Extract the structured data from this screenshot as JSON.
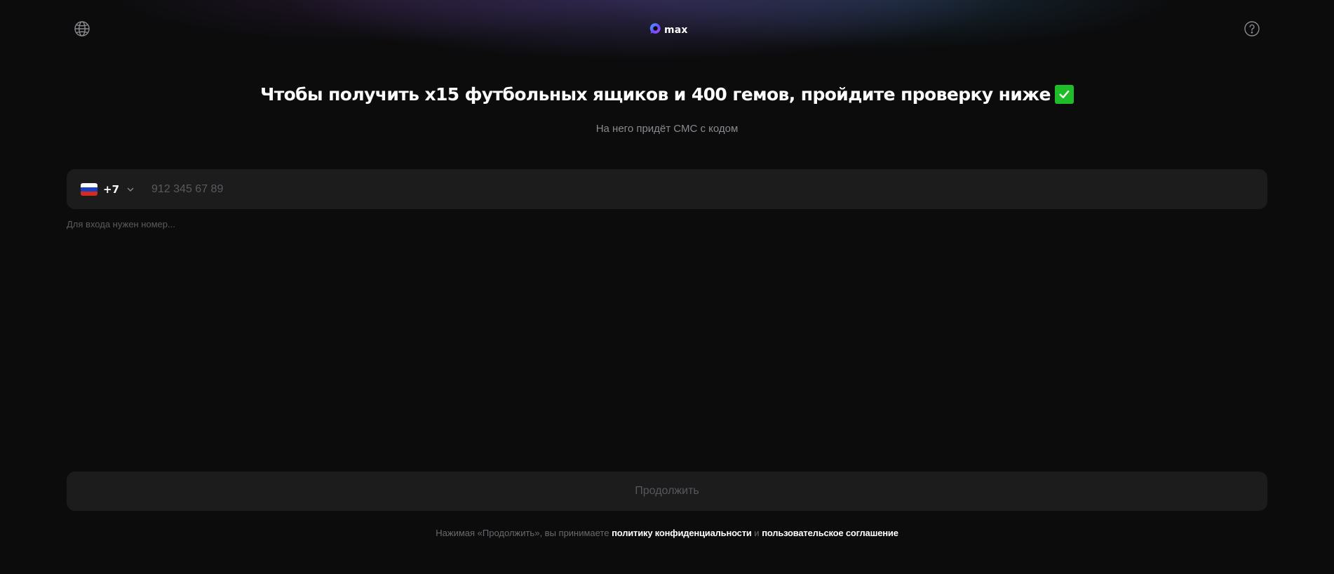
{
  "header": {
    "language_icon": "globe-icon",
    "logo_text": "max",
    "help_icon": "help-circle-icon"
  },
  "main": {
    "title": "Чтобы получить x15 футбольных ящиков и 400 гемов, пройдите проверку ниже",
    "title_emoji": "check-mark-button",
    "subtitle": "На него придёт СМС с кодом",
    "phone": {
      "country_flag": "russia-flag",
      "dial_code": "+7",
      "placeholder": "912 345 67 89",
      "value": ""
    },
    "hint": "Для входа нужен номер..."
  },
  "footer": {
    "continue_label": "Продолжить",
    "legal_prefix": "Нажимая «Продолжить», вы принимаете",
    "privacy_link": "политику конфиденциальности",
    "conjunction": "и",
    "terms_link": "пользовательское соглашение"
  },
  "colors": {
    "background": "#0c0c0d",
    "field_background": "#1c1c1d",
    "emoji_green": "#1fbe28",
    "muted_text": "#8a8a8f"
  }
}
